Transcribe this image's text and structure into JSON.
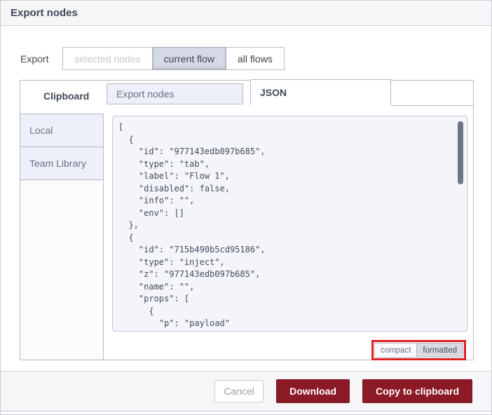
{
  "header": {
    "title": "Export nodes"
  },
  "export_row": {
    "label": "Export",
    "options": [
      {
        "label": "selected nodes",
        "state": "disabled"
      },
      {
        "label": "current flow",
        "state": "selected"
      },
      {
        "label": "all flows",
        "state": "normal"
      }
    ]
  },
  "library": {
    "title": "Clipboard",
    "tabs": [
      {
        "label": "Export nodes",
        "active": false
      },
      {
        "label": "JSON",
        "active": true
      }
    ],
    "items": [
      {
        "label": "Local"
      },
      {
        "label": "Team Library"
      }
    ],
    "json_text": "[\n  {\n    \"id\": \"977143edb097b685\",\n    \"type\": \"tab\",\n    \"label\": \"Flow 1\",\n    \"disabled\": false,\n    \"info\": \"\",\n    \"env\": []\n  },\n  {\n    \"id\": \"715b490b5cd95186\",\n    \"type\": \"inject\",\n    \"z\": \"977143edb097b685\",\n    \"name\": \"\",\n    \"props\": [\n      {\n        \"p\": \"payload\"\n      },",
    "format_toggle": {
      "compact_label": "compact",
      "formatted_label": "formatted",
      "selected": "formatted"
    }
  },
  "footer": {
    "cancel_label": "Cancel",
    "download_label": "Download",
    "copy_label": "Copy to clipboard"
  },
  "colors": {
    "accent_maroon": "#8c1a26",
    "annotation_red": "#dd2222",
    "panel_lavender": "#eef0f9",
    "header_bg": "#f6f6f9"
  }
}
